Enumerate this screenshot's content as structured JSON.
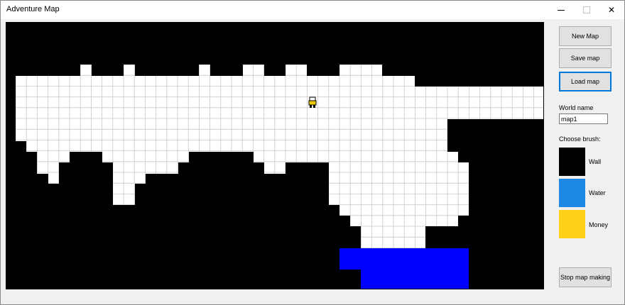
{
  "window": {
    "title": "Adventure Map",
    "minimize_label": "",
    "maximize_label": "",
    "close_label": "✕"
  },
  "toolbar": {
    "new_map_label": "New Map",
    "save_map_label": "Save map",
    "load_map_label": "Load map",
    "stop_label": "Stop map making"
  },
  "world": {
    "label": "World name",
    "value": "map1"
  },
  "brush": {
    "label": "Choose brush:",
    "items": [
      {
        "name": "Wall",
        "color": "#000000"
      },
      {
        "name": "Water",
        "color": "#1e88e5"
      },
      {
        "name": "Money",
        "color": "#ffd21a"
      }
    ]
  },
  "map": {
    "colors": {
      "wall": "#000000",
      "floor": "#ffffff",
      "grid": "#c8c8c8",
      "water": "#0000ff",
      "player": "#f0c800"
    }
  }
}
